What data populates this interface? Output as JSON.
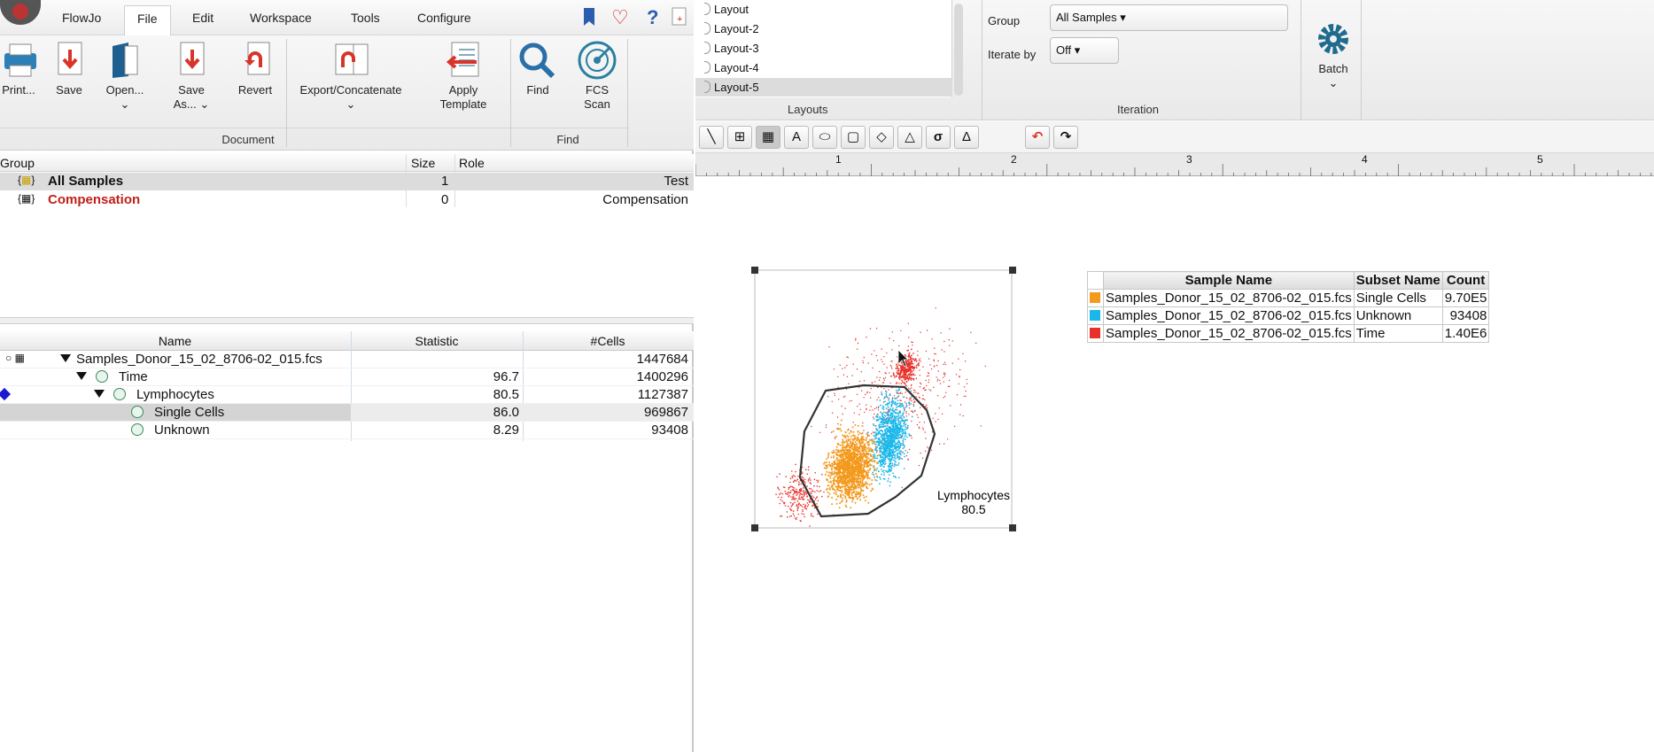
{
  "app": {
    "menu": [
      "FlowJo",
      "File",
      "Edit",
      "Workspace",
      "Tools",
      "Configure"
    ],
    "active_menu": "File"
  },
  "ribbon": {
    "buttons": {
      "print": "Print...",
      "save": "Save",
      "open": "Open...",
      "save_as_1": "Save",
      "save_as_2": "As...",
      "revert": "Revert",
      "export": "Export/Concatenate",
      "apply_1": "Apply",
      "apply_2": "Template",
      "find": "Find",
      "fcs_1": "FCS",
      "fcs_2": "Scan"
    },
    "groups": {
      "document": "Document",
      "find": "Find"
    }
  },
  "groups_table": {
    "headers": {
      "group": "Group",
      "size": "Size",
      "role": "Role"
    },
    "rows": [
      {
        "name": "All Samples",
        "size": "1",
        "role": "Test",
        "color": "#111111"
      },
      {
        "name": "Compensation",
        "size": "0",
        "role": "Compensation",
        "color": "#c0201a"
      }
    ]
  },
  "samples_table": {
    "headers": {
      "name": "Name",
      "statistic": "Statistic",
      "cells": "#Cells"
    },
    "rows": [
      {
        "name": "Samples_Donor_15_02_8706-02_015.fcs",
        "statistic": "",
        "cells": "1447684"
      },
      {
        "name": "Time",
        "statistic": "96.7",
        "cells": "1400296"
      },
      {
        "name": "Lymphocytes",
        "statistic": "80.5",
        "cells": "1127387"
      },
      {
        "name": "Single Cells",
        "statistic": "86.0",
        "cells": "969867"
      },
      {
        "name": "Unknown",
        "statistic": "8.29",
        "cells": "93408"
      }
    ]
  },
  "layouts": {
    "items": [
      "Layout",
      "Layout-2",
      "Layout-3",
      "Layout-4",
      "Layout-5"
    ],
    "selected": "Layout-5",
    "section": "Layouts"
  },
  "iteration": {
    "group_label": "Group",
    "group_value": "All Samples ▾",
    "iterate_label": "Iterate by",
    "iterate_value": "Off ▾",
    "section": "Iteration",
    "batch": "Batch"
  },
  "ruler": [
    "1",
    "2",
    "3",
    "4",
    "5"
  ],
  "plot": {
    "gate_name": "Lymphocytes",
    "gate_value": "80.5"
  },
  "legend": {
    "headers": {
      "sample": "Sample Name",
      "subset": "Subset Name",
      "count": "Count"
    },
    "rows": [
      {
        "color": "#f39a1e",
        "sample": "Samples_Donor_15_02_8706-02_015.fcs",
        "subset": "Single Cells",
        "count": "9.70E5"
      },
      {
        "color": "#1ab8ea",
        "sample": "Samples_Donor_15_02_8706-02_015.fcs",
        "subset": "Unknown",
        "count": "93408"
      },
      {
        "color": "#e8302a",
        "sample": "Samples_Donor_15_02_8706-02_015.fcs",
        "subset": "Time",
        "count": "1.40E6"
      }
    ]
  }
}
